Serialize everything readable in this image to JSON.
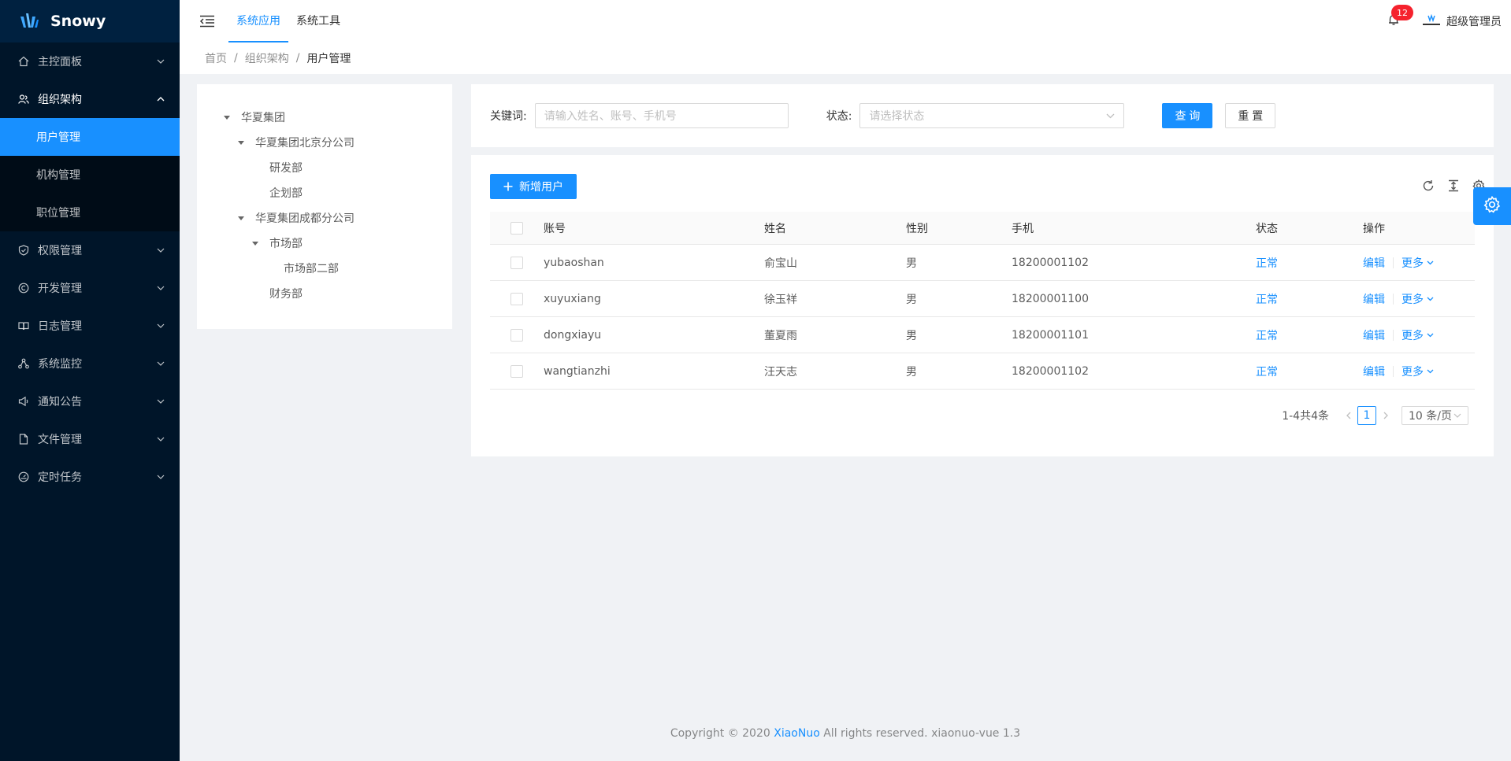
{
  "brand": {
    "name": "Snowy"
  },
  "sidebar": {
    "items": [
      {
        "label": "主控面板",
        "icon": "home-icon",
        "expanded": false
      },
      {
        "label": "组织架构",
        "icon": "team-icon",
        "expanded": true,
        "children": [
          {
            "label": "用户管理",
            "active": true
          },
          {
            "label": "机构管理",
            "active": false
          },
          {
            "label": "职位管理",
            "active": false
          }
        ]
      },
      {
        "label": "权限管理",
        "icon": "shield-icon",
        "expanded": false
      },
      {
        "label": "开发管理",
        "icon": "copyright-icon",
        "expanded": false
      },
      {
        "label": "日志管理",
        "icon": "book-icon",
        "expanded": false
      },
      {
        "label": "系统监控",
        "icon": "cluster-icon",
        "expanded": false
      },
      {
        "label": "通知公告",
        "icon": "sound-icon",
        "expanded": false
      },
      {
        "label": "文件管理",
        "icon": "file-icon",
        "expanded": false
      },
      {
        "label": "定时任务",
        "icon": "dashboard-icon",
        "expanded": false
      }
    ]
  },
  "header": {
    "tabs": [
      {
        "label": "系统应用",
        "active": true
      },
      {
        "label": "系统工具",
        "active": false
      }
    ],
    "notification_count": "12",
    "username": "超级管理员"
  },
  "breadcrumb": [
    "首页",
    "组织架构",
    "用户管理"
  ],
  "tree": [
    {
      "label": "华夏集团",
      "level": 0,
      "expandable": true
    },
    {
      "label": "华夏集团北京分公司",
      "level": 1,
      "expandable": true
    },
    {
      "label": "研发部",
      "level": 2,
      "expandable": false
    },
    {
      "label": "企划部",
      "level": 2,
      "expandable": false
    },
    {
      "label": "华夏集团成都分公司",
      "level": 1,
      "expandable": true
    },
    {
      "label": "市场部",
      "level": 2,
      "expandable": true
    },
    {
      "label": "市场部二部",
      "level": 3,
      "expandable": false
    },
    {
      "label": "财务部",
      "level": 2,
      "expandable": false
    }
  ],
  "search": {
    "keyword_label": "关键词:",
    "keyword_placeholder": "请输入姓名、账号、手机号",
    "status_label": "状态:",
    "status_placeholder": "请选择状态",
    "query_label": "查 询",
    "reset_label": "重 置"
  },
  "table": {
    "add_label": "新增用户",
    "columns": [
      "账号",
      "姓名",
      "性别",
      "手机",
      "状态",
      "操作"
    ],
    "rows": [
      {
        "account": "yubaoshan",
        "name": "俞宝山",
        "sex": "男",
        "phone": "18200001102",
        "status": "正常"
      },
      {
        "account": "xuyuxiang",
        "name": "徐玉祥",
        "sex": "男",
        "phone": "18200001100",
        "status": "正常"
      },
      {
        "account": "dongxiayu",
        "name": "董夏雨",
        "sex": "男",
        "phone": "18200001101",
        "status": "正常"
      },
      {
        "account": "wangtianzhi",
        "name": "汪天志",
        "sex": "男",
        "phone": "18200001102",
        "status": "正常"
      }
    ],
    "edit_label": "编辑",
    "more_label": "更多"
  },
  "pagination": {
    "total_text": "1-4共4条",
    "current_page": "1",
    "page_size": "10 条/页"
  },
  "footer": {
    "prefix": "Copyright © 2020 ",
    "link": "XiaoNuo",
    "suffix": " All rights reserved. xiaonuo-vue 1.3"
  },
  "colors": {
    "primary": "#1890ff",
    "sidebar_bg": "#001529",
    "danger": "#f5222d"
  }
}
